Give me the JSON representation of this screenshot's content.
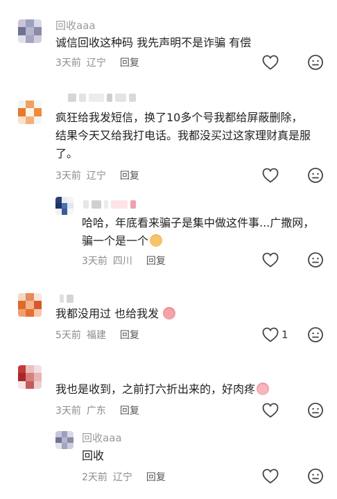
{
  "comments": [
    {
      "username": "回收aaa",
      "text": "诚信回收这种码 我先声明不是诈骗 有偿",
      "time": "3天前",
      "location": "辽宁",
      "reply_label": "回复"
    },
    {
      "username": "",
      "text_line1": "疯狂给我发短信，换了10多个号我都给屏蔽删除，",
      "text_line2": "结果今天又给我打电话。我都没买过这家理财真是服",
      "text_line3": "了。",
      "time": "3天前",
      "location": "辽宁",
      "reply_label": "回复",
      "reply": {
        "username": "",
        "text_line1": "哈哈，年底看来骗子是集中做这件事...广撒网，",
        "text_line2": "骗一个是一个",
        "time": "3天前",
        "location": "四川",
        "reply_label": "回复"
      }
    },
    {
      "username": "",
      "text": "我都没用过 也给我发",
      "time": "5天前",
      "location": "福建",
      "reply_label": "回复",
      "like_count": "1"
    },
    {
      "username": "",
      "text": "我也是收到，之前打六折出来的，好肉疼",
      "time": "3天前",
      "location": "广东",
      "reply_label": "回复",
      "reply": {
        "username": "回收aaa",
        "text": "回收",
        "time": "2天前",
        "location": "辽宁",
        "reply_label": "回复"
      }
    }
  ],
  "icons": {
    "like": "heart-outline-icon",
    "dislike": "meh-face-icon"
  },
  "colors": {
    "text": "#1f1f1f",
    "meta": "#8c8c8c",
    "username": "#9a9a9a",
    "icon": "#444444"
  }
}
